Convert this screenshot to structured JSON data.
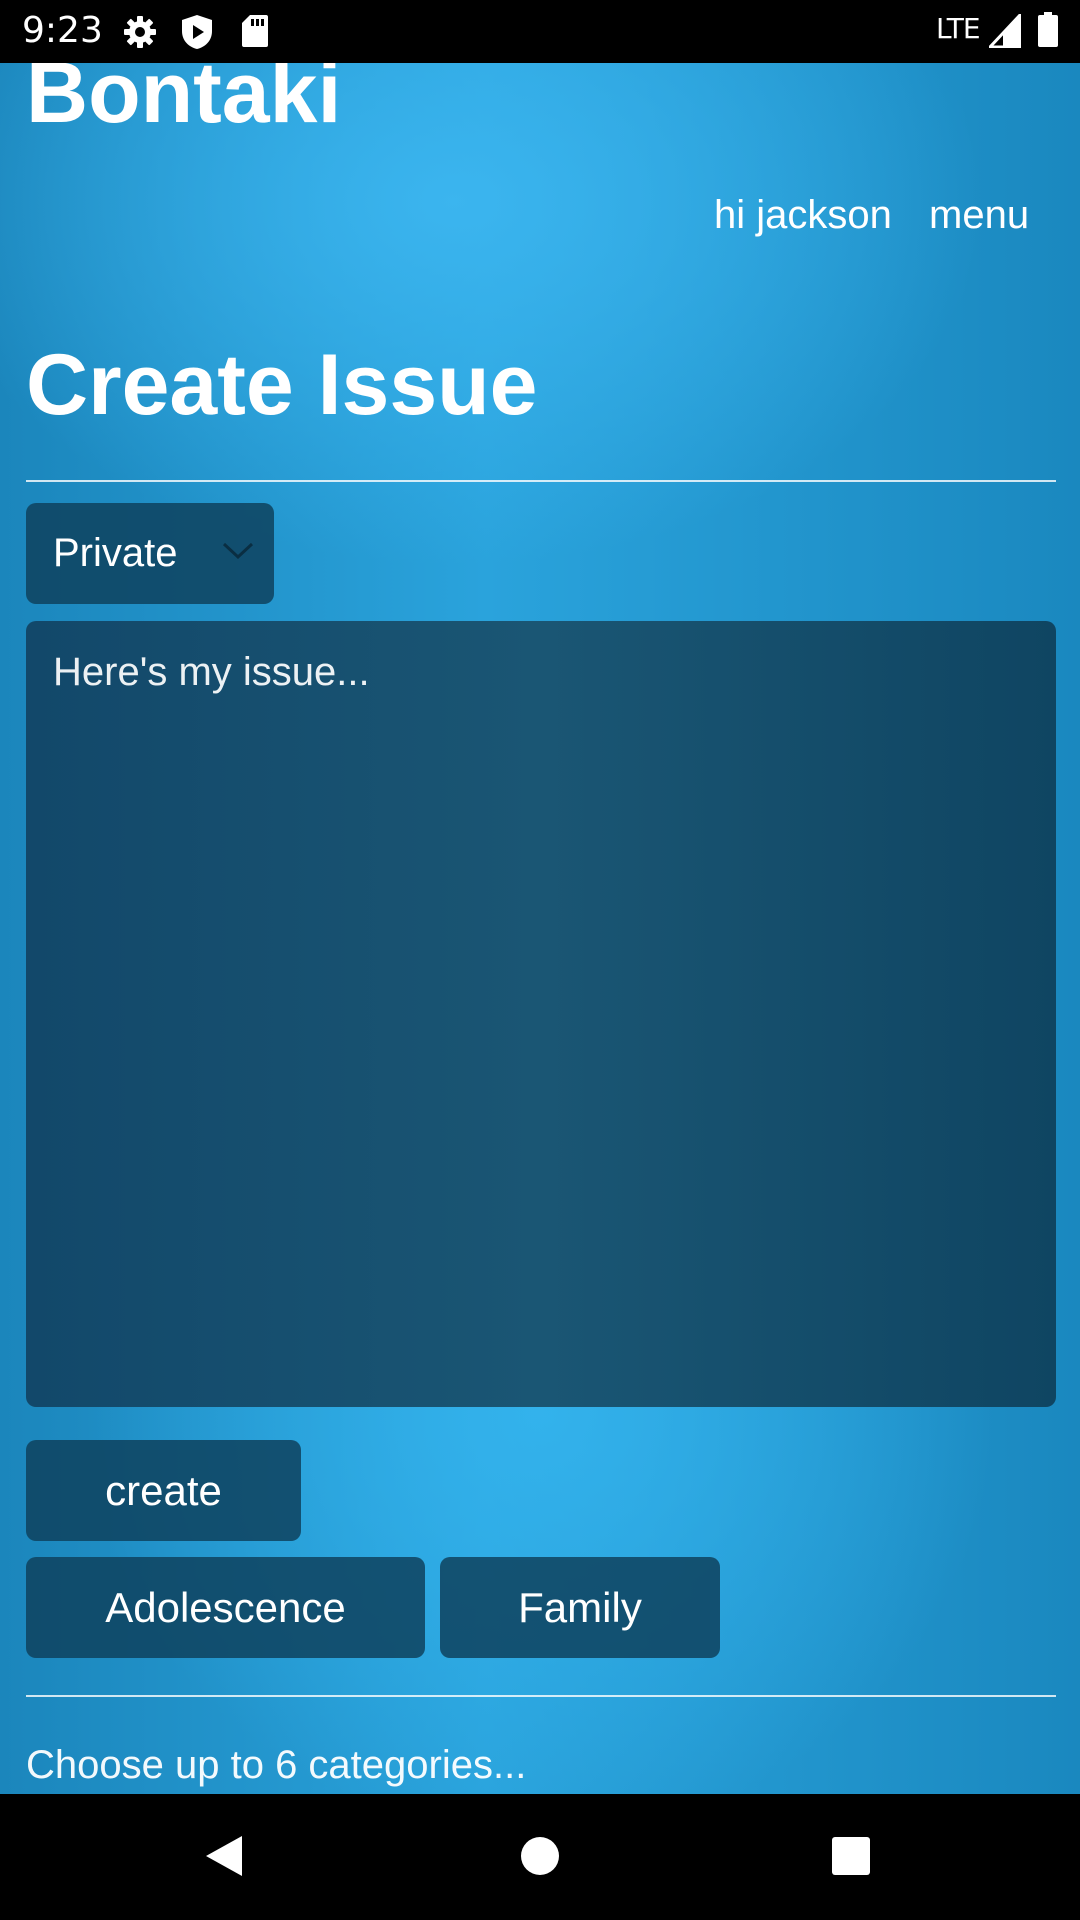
{
  "status_bar": {
    "time": "9:23",
    "network": "LTE",
    "icons": [
      "settings-icon",
      "shield-play-icon",
      "sd-card-icon",
      "signal-icon",
      "battery-icon"
    ]
  },
  "header": {
    "brand": "Bontaki",
    "greeting": "hi jackson",
    "menu_label": "menu"
  },
  "page": {
    "title": "Create Issue"
  },
  "form": {
    "visibility_value": "Private",
    "issue_placeholder": "Here's my issue...",
    "create_label": "create",
    "categories": [
      "Adolescence",
      "Family"
    ],
    "categories_hint": "Choose up to 6 categories..."
  },
  "nav_bar": {
    "icons": [
      "back-icon",
      "home-icon",
      "recents-icon"
    ]
  },
  "colors": {
    "background_light": "#36b1ea",
    "background_dark": "#1a86bc",
    "control_bg": "#0e425e",
    "text": "#ffffff"
  }
}
